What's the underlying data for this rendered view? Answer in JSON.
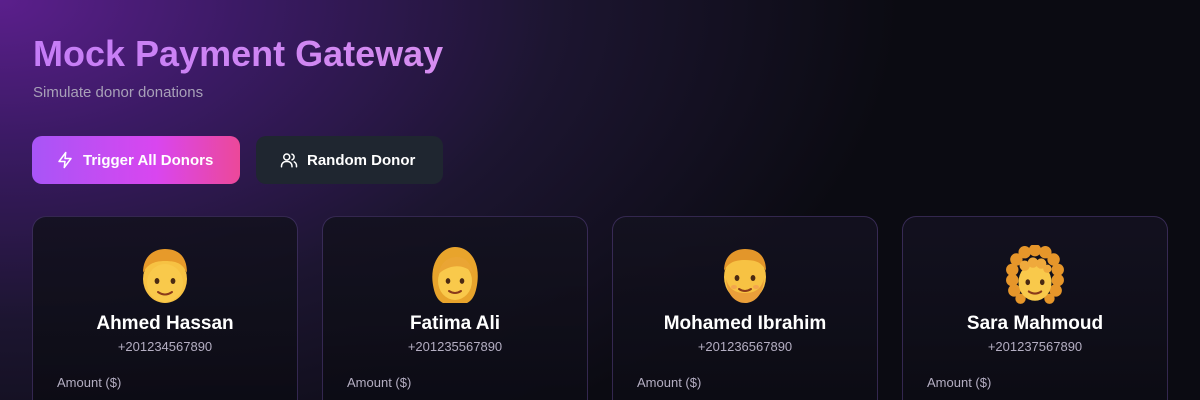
{
  "header": {
    "title": "Mock Payment Gateway",
    "subtitle": "Simulate donor donations"
  },
  "actions": {
    "trigger_all_label": "Trigger All Donors",
    "trigger_all_icon": "lightning-icon",
    "random_donor_label": "Random Donor",
    "random_donor_icon": "users-icon"
  },
  "donors": [
    {
      "name": "Ahmed Hassan",
      "phone": "+201234567890",
      "amount_label": "Amount ($)",
      "avatar": "man-emoji-avatar"
    },
    {
      "name": "Fatima Ali",
      "phone": "+201235567890",
      "amount_label": "Amount ($)",
      "avatar": "woman-emoji-avatar"
    },
    {
      "name": "Mohamed Ibrahim",
      "phone": "+201236567890",
      "amount_label": "Amount ($)",
      "avatar": "bearded-man-emoji-avatar"
    },
    {
      "name": "Sara Mahmoud",
      "phone": "+201237567890",
      "amount_label": "Amount ($)",
      "avatar": "curly-hair-woman-emoji-avatar"
    }
  ],
  "colors": {
    "title_gradient": [
      "#c57cf7",
      "#d68df0"
    ],
    "primary_button_gradient": [
      "#a855f7",
      "#d946ef",
      "#ec4899"
    ],
    "secondary_button": "#1f2630",
    "card_border": "#7e5cbe"
  }
}
